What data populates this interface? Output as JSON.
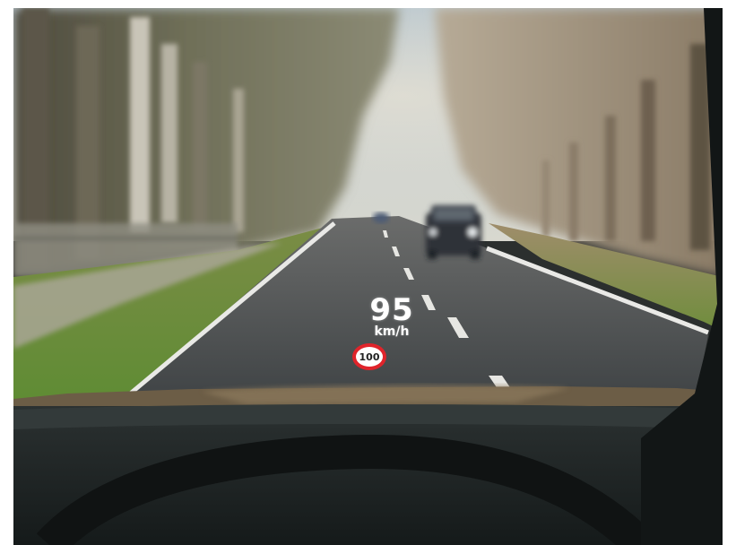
{
  "hud": {
    "speed": "95",
    "unit": "km/h",
    "speed_limit": "100"
  },
  "colors": {
    "sign_ring": "#e0242b",
    "hud_text": "#ffffff",
    "road": "#45494b",
    "grass": "#6f8a3a",
    "dashboard": "#202524"
  }
}
